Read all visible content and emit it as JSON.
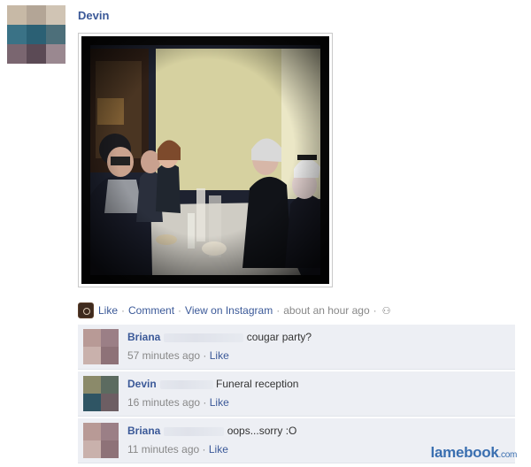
{
  "post": {
    "author": "Devin",
    "actions": {
      "like": "Like",
      "comment": "Comment",
      "view_on_instagram": "View on Instagram",
      "timestamp": "about an hour ago",
      "separator": "·"
    },
    "icons": {
      "instagram": "instagram-icon",
      "audience": "friends-audience-icon"
    }
  },
  "comments": [
    {
      "author": "Briana",
      "text": "cougar party?",
      "time": "57 minutes ago",
      "like": "Like",
      "avatar_colors": [
        "#b89a96",
        "#9b7f86",
        "#c9b1ac",
        "#8e7278"
      ]
    },
    {
      "author": "Devin",
      "text": "Funeral reception",
      "time": "16 minutes ago",
      "like": "Like",
      "avatar_colors": [
        "#8b8a6a",
        "#5c6b60",
        "#2f5564",
        "#6d5e63"
      ]
    },
    {
      "author": "Briana",
      "text": "oops...sorry :O",
      "time": "11 minutes ago",
      "like": "Like",
      "avatar_colors": [
        "#b89a96",
        "#9b7f86",
        "#c9b1ac",
        "#8e7278"
      ]
    }
  ],
  "watermark": {
    "main": "lamebook",
    "suffix": ".com"
  },
  "colors": {
    "link": "#3b5998",
    "comment_bg": "#edeff4",
    "meta": "#888888"
  }
}
